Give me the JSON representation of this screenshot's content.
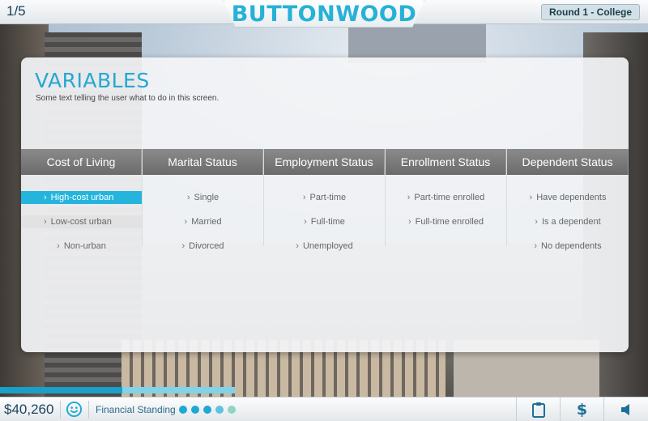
{
  "header": {
    "counter": "1/5",
    "brand": "BUTTONWOOD",
    "round_label": "Round 1 - College"
  },
  "panel": {
    "title": "VARIABLES",
    "subtitle": "Some text telling the user what to do in this screen.",
    "columns": [
      {
        "header": "Cost of Living",
        "options": [
          {
            "label": "High-cost urban",
            "state": "selected"
          },
          {
            "label": "Low-cost urban",
            "state": "highlighted"
          },
          {
            "label": "Non-urban",
            "state": "normal"
          }
        ]
      },
      {
        "header": "Marital Status",
        "options": [
          {
            "label": "Single",
            "state": "normal"
          },
          {
            "label": "Married",
            "state": "normal"
          },
          {
            "label": "Divorced",
            "state": "normal"
          }
        ]
      },
      {
        "header": "Employment Status",
        "options": [
          {
            "label": "Part-time",
            "state": "normal"
          },
          {
            "label": "Full-time",
            "state": "normal"
          },
          {
            "label": "Unemployed",
            "state": "normal"
          }
        ]
      },
      {
        "header": "Enrollment Status",
        "options": [
          {
            "label": "Part-time enrolled",
            "state": "normal"
          },
          {
            "label": "Full-time enrolled",
            "state": "normal"
          }
        ]
      },
      {
        "header": "Dependent Status",
        "options": [
          {
            "label": "Have dependents",
            "state": "normal"
          },
          {
            "label": "Is a dependent",
            "state": "normal"
          },
          {
            "label": "No dependents",
            "state": "normal"
          }
        ]
      }
    ]
  },
  "footer": {
    "progress_fraction": 0.52,
    "money": "$40,260",
    "financial_label": "Financial Standing",
    "standing_dots": [
      "#1fa8d3",
      "#1fa8d3",
      "#1fa8d3",
      "#5ec3de",
      "#8fd5c3"
    ],
    "icons": [
      "clipboard-icon",
      "dollar-icon",
      "speaker-icon"
    ],
    "dollar_glyph": "$"
  },
  "colors": {
    "accent": "#25b5dc",
    "brand": "#27b1d6",
    "header_gray": "#7a7a7a"
  }
}
